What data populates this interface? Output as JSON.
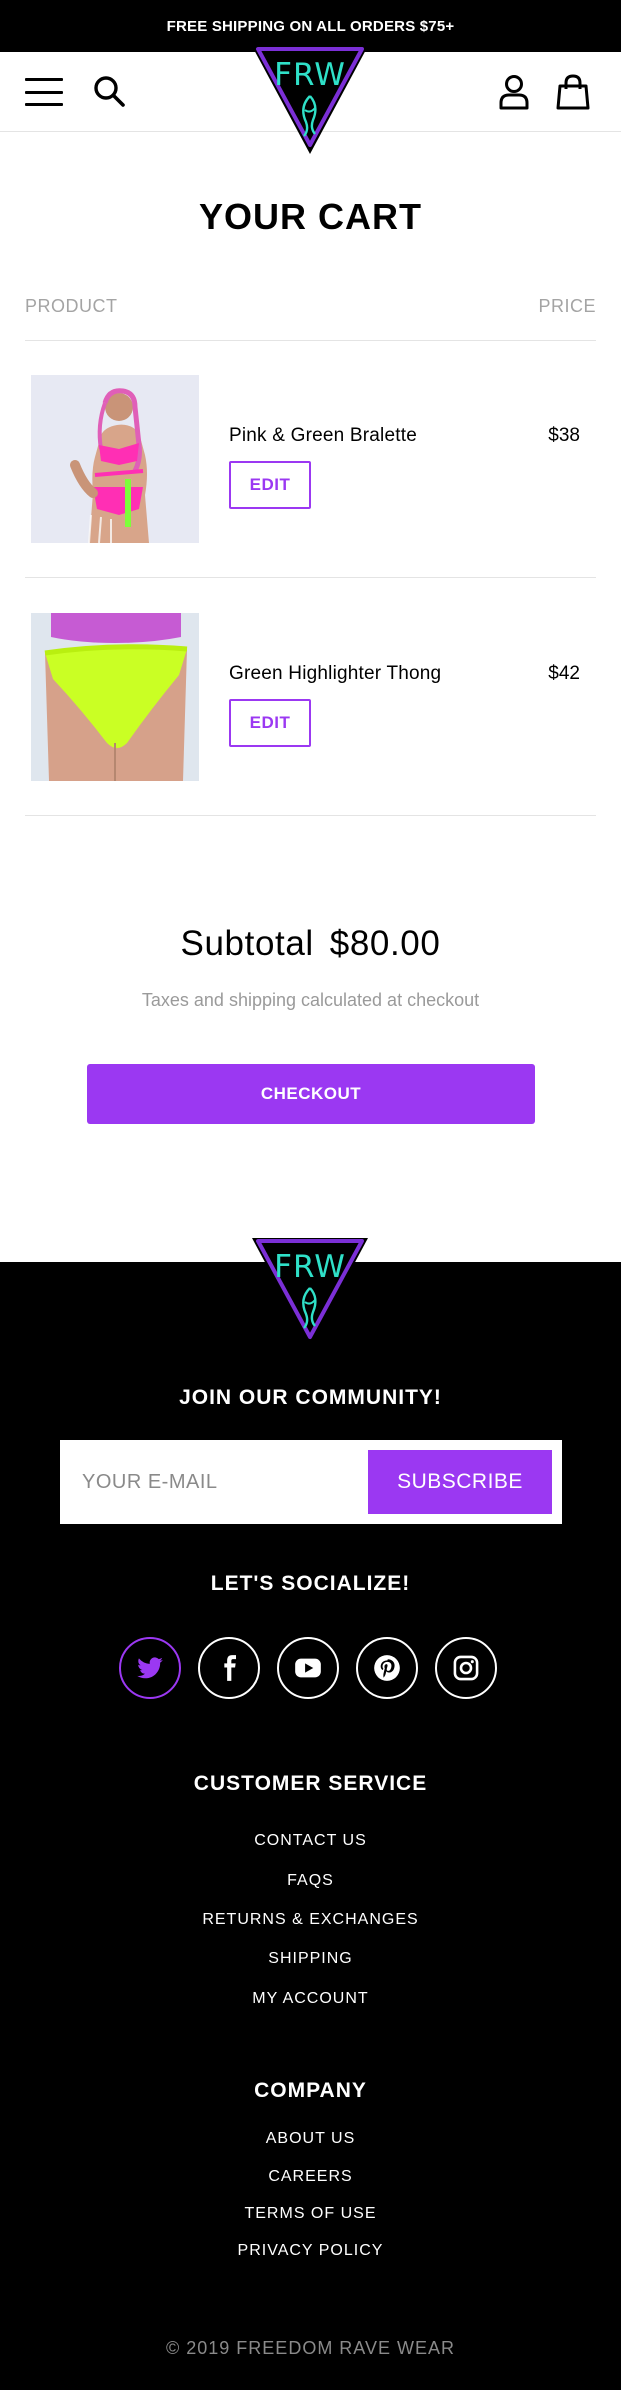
{
  "announcement": "FREE SHIPPING ON ALL ORDERS $75+",
  "brand": {
    "logo_text": "FRW",
    "accent": "#9b38f2",
    "logo_outline": "#7b2fd6",
    "logo_teal": "#2fe0c8"
  },
  "header": {
    "icons": [
      "menu-icon",
      "search-icon",
      "account-icon",
      "shopping-bag-icon"
    ]
  },
  "cart": {
    "title": "YOUR CART",
    "col_product": "PRODUCT",
    "col_price": "PRICE",
    "items": [
      {
        "name": "Pink & Green Bralette",
        "price": "$38",
        "edit_label": "EDIT"
      },
      {
        "name": "Green Highlighter Thong",
        "price": "$42",
        "edit_label": "EDIT"
      }
    ],
    "subtotal_label": "Subtotal",
    "subtotal_value": "$80.00",
    "tax_note": "Taxes and shipping calculated at checkout",
    "checkout_label": "CHECKOUT"
  },
  "footer": {
    "join_heading": "JOIN OUR COMMUNITY!",
    "email_placeholder": "YOUR E-MAIL",
    "subscribe_label": "SUBSCRIBE",
    "social_heading": "LET'S SOCIALIZE!",
    "socials": [
      "twitter-icon",
      "facebook-icon",
      "youtube-icon",
      "pinterest-icon",
      "instagram-icon"
    ],
    "customer_service_heading": "CUSTOMER SERVICE",
    "customer_service_links": [
      "CONTACT US",
      "FAQS",
      "RETURNS & EXCHANGES",
      "SHIPPING",
      "MY ACCOUNT"
    ],
    "company_heading": "COMPANY",
    "company_links": [
      "ABOUT US",
      "CAREERS",
      "TERMS OF USE",
      "PRIVACY POLICY"
    ],
    "copyright": "© 2019 FREEDOM RAVE WEAR"
  }
}
